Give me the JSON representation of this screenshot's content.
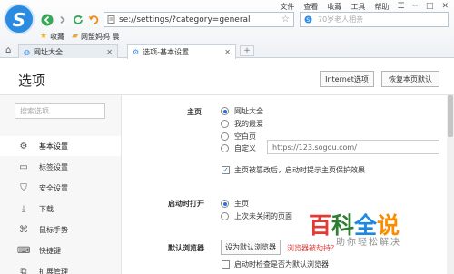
{
  "browser": {
    "logo_letter": "S",
    "menu": [
      "文件",
      "查看",
      "收藏",
      "工具",
      "帮助"
    ],
    "window_controls": [
      "☰",
      "─",
      "□",
      "✕"
    ],
    "address": "se://settings/?category=general",
    "search_placeholder": "70岁老人相亲",
    "bookmarks": [
      {
        "icon": "star-icon",
        "label": "收藏"
      },
      {
        "icon": "folder-icon",
        "label": "网盟妈妈 晨"
      }
    ],
    "tabs": [
      {
        "icon": "globe-icon",
        "label": "网址大全",
        "close": "✕",
        "active": false
      },
      {
        "icon": "gear-icon",
        "label": "选项-基本设置",
        "close": "✕",
        "active": true
      }
    ],
    "new_tab": "+"
  },
  "page": {
    "title": "选项",
    "internet_options": "Internet选项",
    "restore_defaults": "恢复本页默认"
  },
  "sidebar": {
    "search_placeholder": "搜索选项",
    "items": [
      {
        "icon": "gear-icon",
        "label": "基本设置",
        "active": true
      },
      {
        "icon": "tab-icon",
        "label": "标签设置",
        "active": false
      },
      {
        "icon": "shield-icon",
        "label": "安全设置",
        "active": false
      },
      {
        "icon": "download-icon",
        "label": "下载",
        "active": false
      },
      {
        "icon": "mouse-icon",
        "label": "鼠标手势",
        "active": false
      },
      {
        "icon": "keyboard-icon",
        "label": "快捷键",
        "active": false
      },
      {
        "icon": "extension-icon",
        "label": "扩展管理",
        "active": false
      }
    ]
  },
  "homepage": {
    "label": "主页",
    "options": [
      "网址大全",
      "我的最爱",
      "空白页",
      "自定义"
    ],
    "selected": 0,
    "custom_url": "https://123.sogou.com/",
    "protect_label": "主页被篡改后，启动时提示主页保护效果",
    "protect_checked": true
  },
  "startup": {
    "label": "启动时打开",
    "options": [
      "主页",
      "上次未关闭的页面"
    ],
    "selected": 0
  },
  "default_browser": {
    "label": "默认浏览器",
    "button": "设为默认浏览器",
    "warning_link": "浏览器被劫持？",
    "check_label": "启动时检查是否为默认浏览器",
    "check_checked": false
  },
  "watermark": {
    "text": "百科全说",
    "caption": "助你轻松解决",
    "colors": {
      "bai": "#e53935",
      "ke": "#2e7d32",
      "quan": "#1e88e5",
      "shuo": "#fb8c00"
    }
  }
}
